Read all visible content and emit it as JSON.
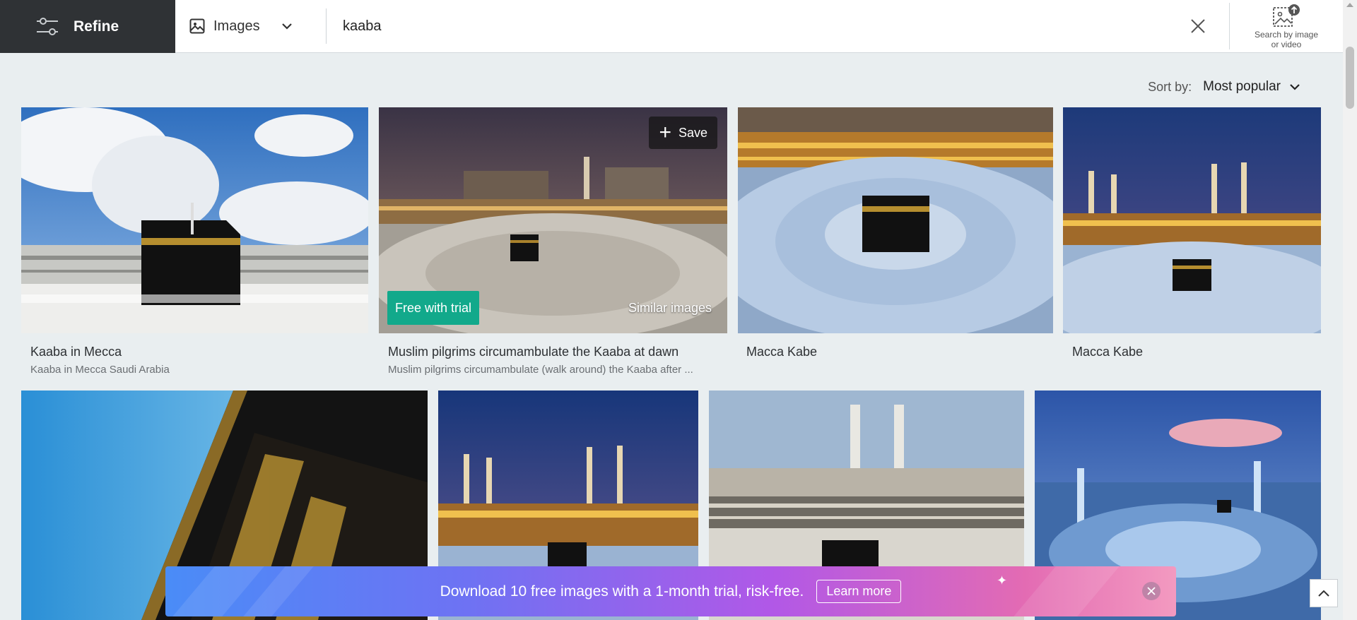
{
  "header": {
    "refine_label": "Refine",
    "media_type": "Images",
    "search_value": "kaaba",
    "search_by_image_line1": "Search by image",
    "search_by_image_line2": "or video"
  },
  "sort": {
    "label": "Sort by:",
    "value": "Most popular"
  },
  "results": [
    {
      "title": "Kaaba in Mecca",
      "subtitle": "Kaaba in Mecca Saudi Arabia"
    },
    {
      "title": "Muslim pilgrims circumambulate the Kaaba at dawn",
      "subtitle": "Muslim pilgrims circumambulate (walk around) the Kaaba after ...",
      "save_label": "Save",
      "badge": "Free with trial",
      "similar_label": "Similar images"
    },
    {
      "title": "Macca Kabe",
      "subtitle": ""
    },
    {
      "title": "Macca Kabe",
      "subtitle": ""
    }
  ],
  "promo": {
    "message": "Download 10 free images with a 1-month trial, risk-free.",
    "button": "Learn more"
  },
  "colors": {
    "refine_bg": "#2f3235",
    "badge_green": "#12a98b",
    "page_bg": "#e9eef0"
  }
}
